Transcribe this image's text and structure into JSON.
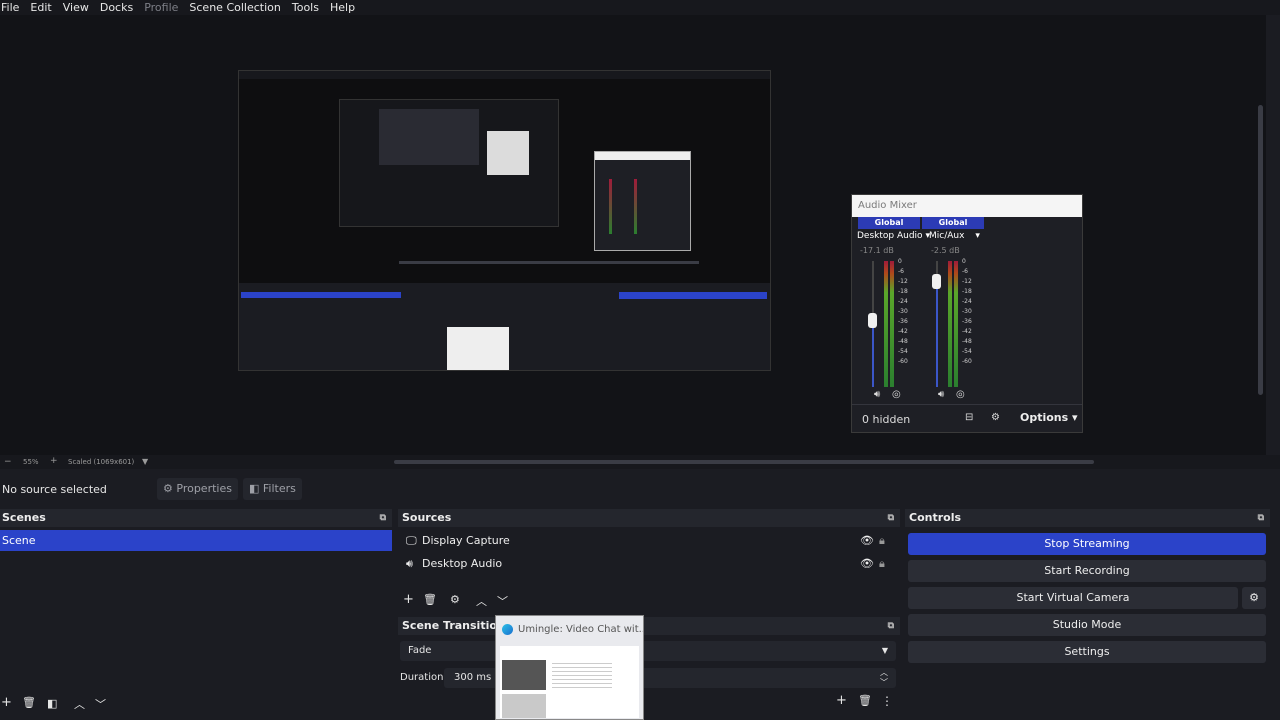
{
  "menu": [
    "File",
    "Edit",
    "View",
    "Docks",
    "Profile",
    "Scene Collection",
    "Tools",
    "Help"
  ],
  "mixer": {
    "title": "Audio Mixer",
    "channels": [
      {
        "head": "Global",
        "name": "Desktop Audio",
        "db": "-17.1 dB"
      },
      {
        "head": "Global",
        "name": "Mic/Aux",
        "db": "-2.5 dB"
      }
    ],
    "scale": [
      "0",
      "-6",
      "-12",
      "-18",
      "-24",
      "-30",
      "-36",
      "-42",
      "-48",
      "-54",
      "-60"
    ],
    "hidden": "0 hidden",
    "options": "Options"
  },
  "zoom": {
    "minus": "−",
    "pct": "55%",
    "plus": "+",
    "scaled": "Scaled (1069x601)"
  },
  "properties": {
    "no_source": "No source selected",
    "properties_btn": "Properties",
    "filters_btn": "Filters"
  },
  "scenes": {
    "title": "Scenes",
    "items": [
      "Scene"
    ]
  },
  "sources": {
    "title": "Sources",
    "items": [
      "Display Capture",
      "Desktop Audio"
    ]
  },
  "transitions": {
    "title": "Scene Transitions",
    "type": "Fade",
    "duration_label": "Duration",
    "duration_value": "300 ms"
  },
  "controls": {
    "title": "Controls",
    "stop_streaming": "Stop Streaming",
    "start_recording": "Start Recording",
    "start_virtual_camera": "Start Virtual Camera",
    "studio_mode": "Studio Mode",
    "settings": "Settings"
  },
  "taskbar_thumb": {
    "title": "Umingle: Video Chat wit..."
  },
  "colors": {
    "accent": "#2b43c9",
    "background": "#1b1c22",
    "panel": "#24262d"
  }
}
